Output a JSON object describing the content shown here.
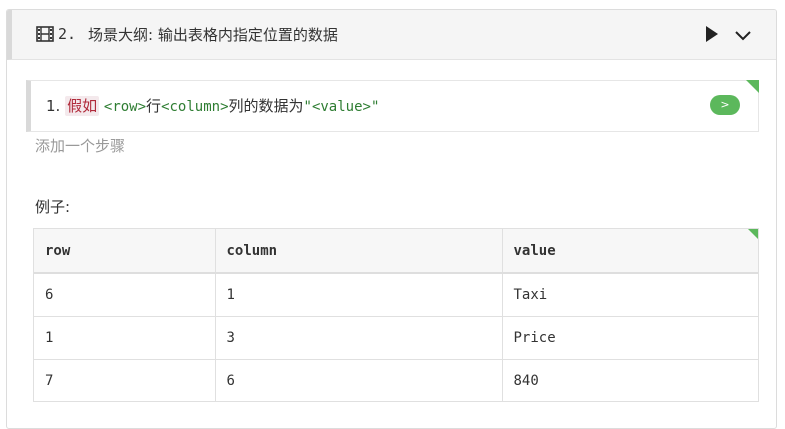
{
  "scenario": {
    "number": "2.",
    "title": "场景大纲: 输出表格内指定位置的数据"
  },
  "step": {
    "index": "1.",
    "keyword": "假如",
    "parts": [
      "<row>",
      "行",
      "<column>",
      "列的数据为",
      "\"<value>\""
    ],
    "run_label": ">"
  },
  "add_step_label": "添加一个步骤",
  "example_label": "例子:",
  "examples": {
    "headers": [
      "row",
      "column",
      "value"
    ],
    "rows": [
      [
        "6",
        "1",
        "Taxi"
      ],
      [
        "1",
        "3",
        "Price"
      ],
      [
        "7",
        "6",
        "840"
      ]
    ]
  },
  "icons": {
    "film": "film-icon",
    "play": "play-icon",
    "chevron": "chevron-down-icon"
  },
  "colors": {
    "accent": "#5cb85c",
    "keyword": "#b02a3a",
    "placeholder": "#2e7d32"
  }
}
